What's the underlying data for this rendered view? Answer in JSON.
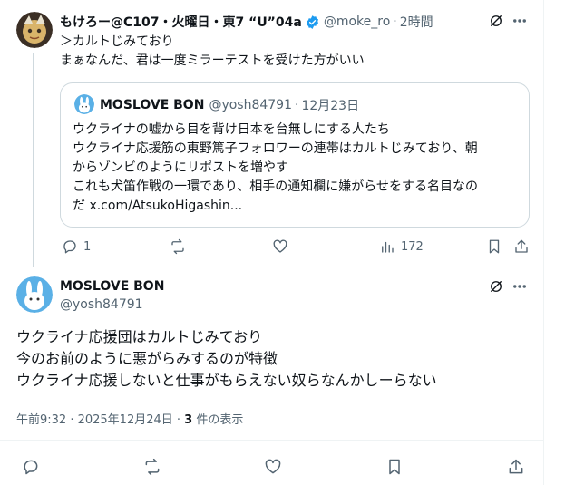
{
  "reply": {
    "author_name": "もけろー@C107・火曜日・東7 “U”04a",
    "handle": "@moke_ro",
    "time": "2時間",
    "line1": "＞カルトじみており",
    "line2": "まぁなんだ、君は一度ミラーテストを受けた方がいい",
    "actions": {
      "reply_count": "1",
      "views_count": "172"
    }
  },
  "quote": {
    "author_name": "MOSLOVE BON",
    "handle": "@yosh84791",
    "date": "12月23日",
    "line1": "ウクライナの嘘から目を背け日本を台無しにする人たち",
    "line2": "ウクライナ応援筋の東野篤子フォロワーの連帯はカルトじみており、朝",
    "line3": "からゾンビのようにリポストを増やす",
    "line4": "これも犬笛作戦の一環であり、相手の通知欄に嫌がらせをする名目なの",
    "line5": "だ x.com/AtsukoHigashin..."
  },
  "main": {
    "author_name": "MOSLOVE BON",
    "handle": "@yosh84791",
    "line1": "ウクライナ応援団はカルトじみており",
    "line2": "今のお前のように悪がらみするのが特徴",
    "line3": "ウクライナ応援しないと仕事がもらえない奴らなんかしーらない",
    "timestamp": "午前9:32 · 2025年12月24日 · ",
    "views_count": "3",
    "views_label": " 件の表示"
  },
  "colors": {
    "verified": "#1d9bf0",
    "text": "#0f1419",
    "muted": "#536471",
    "border": "#cfd9de"
  },
  "icons": [
    "reply-icon",
    "retweet-icon",
    "like-icon",
    "views-icon",
    "bookmark-icon",
    "share-icon",
    "grok-icon",
    "more-icon",
    "verified-icon"
  ]
}
